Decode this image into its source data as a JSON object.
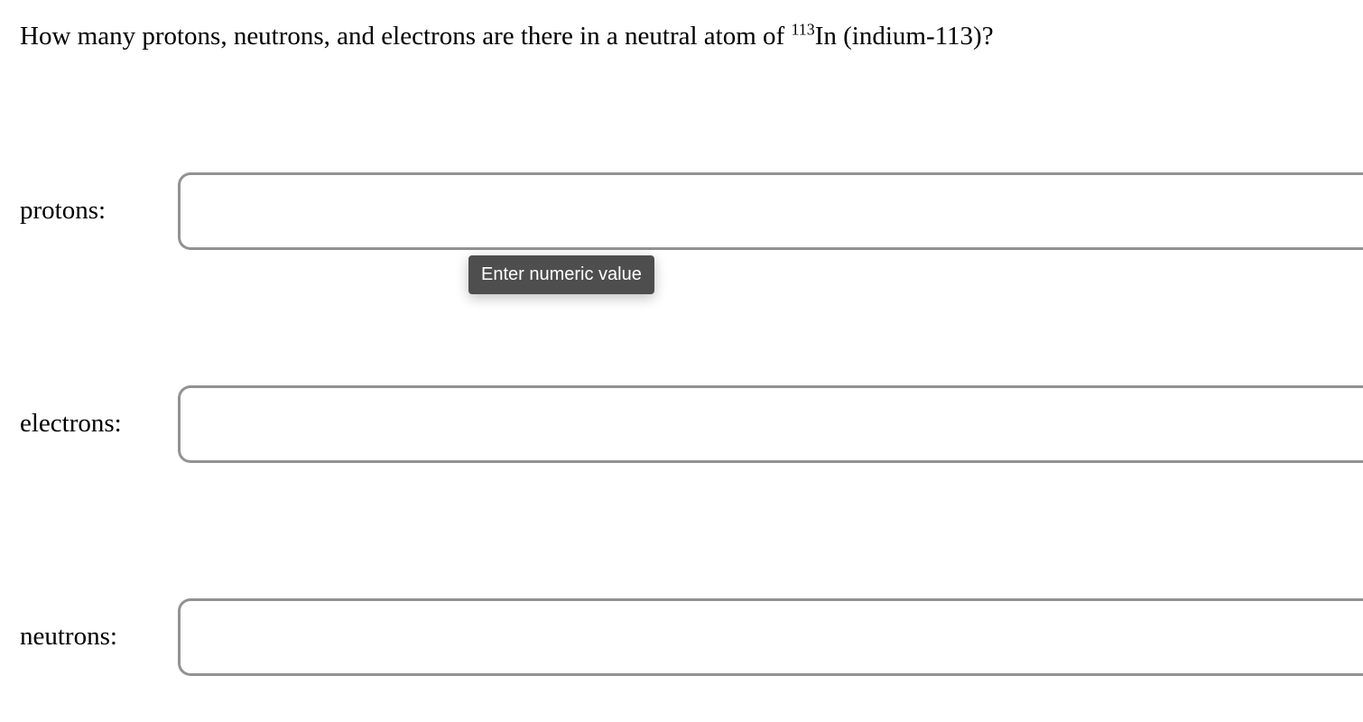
{
  "question": {
    "text_before_sup": "How many protons, neutrons, and electrons are there in a neutral atom of ",
    "sup": "113",
    "text_after_sup": "In (indium-113)?"
  },
  "fields": {
    "protons": {
      "label": "protons:",
      "value": ""
    },
    "electrons": {
      "label": "electrons:",
      "value": ""
    },
    "neutrons": {
      "label": "neutrons:",
      "value": ""
    }
  },
  "tooltip": {
    "text": "Enter numeric value"
  }
}
